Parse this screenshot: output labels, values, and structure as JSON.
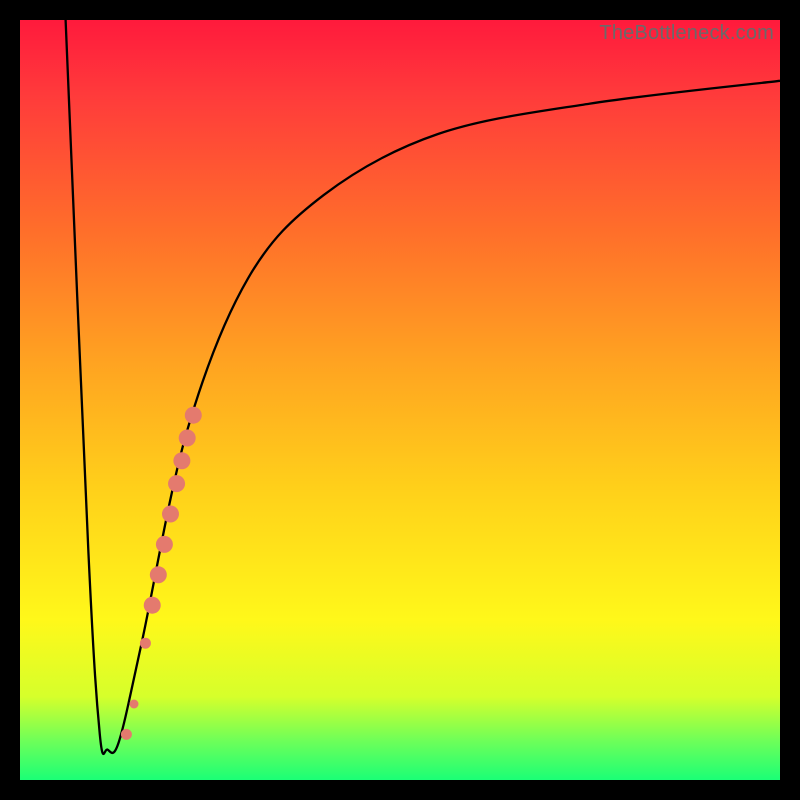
{
  "watermark": "TheBottleneck.com",
  "chart_data": {
    "type": "line",
    "title": "",
    "xlabel": "",
    "ylabel": "",
    "xlim": [
      0,
      100
    ],
    "ylim": [
      0,
      100
    ],
    "series": [
      {
        "name": "bottleneck-curve",
        "description": "Black line: descends sharply to a minimum near x≈11 then rises asymptotically toward y≈92",
        "points": [
          {
            "x": 6.0,
            "y": 100
          },
          {
            "x": 9.0,
            "y": 30
          },
          {
            "x": 10.5,
            "y": 6
          },
          {
            "x": 11.5,
            "y": 4
          },
          {
            "x": 13.0,
            "y": 5
          },
          {
            "x": 16.0,
            "y": 18
          },
          {
            "x": 22.0,
            "y": 46
          },
          {
            "x": 30.0,
            "y": 66
          },
          {
            "x": 40.0,
            "y": 77
          },
          {
            "x": 55.0,
            "y": 85
          },
          {
            "x": 75.0,
            "y": 89
          },
          {
            "x": 100.0,
            "y": 92
          }
        ]
      },
      {
        "name": "highlight-cluster",
        "description": "Salmon dots clustered along rising arm between minimum and y≈50",
        "points": [
          {
            "x": 14.0,
            "y": 6,
            "size": "med"
          },
          {
            "x": 15.0,
            "y": 10,
            "size": "sml"
          },
          {
            "x": 16.5,
            "y": 18,
            "size": "med"
          },
          {
            "x": 17.4,
            "y": 23,
            "size": "big"
          },
          {
            "x": 18.2,
            "y": 27,
            "size": "big"
          },
          {
            "x": 19.0,
            "y": 31,
            "size": "big"
          },
          {
            "x": 19.8,
            "y": 35,
            "size": "big"
          },
          {
            "x": 20.6,
            "y": 39,
            "size": "big"
          },
          {
            "x": 21.3,
            "y": 42,
            "size": "big"
          },
          {
            "x": 22.0,
            "y": 45,
            "size": "big"
          },
          {
            "x": 22.8,
            "y": 48,
            "size": "big"
          }
        ]
      }
    ]
  }
}
